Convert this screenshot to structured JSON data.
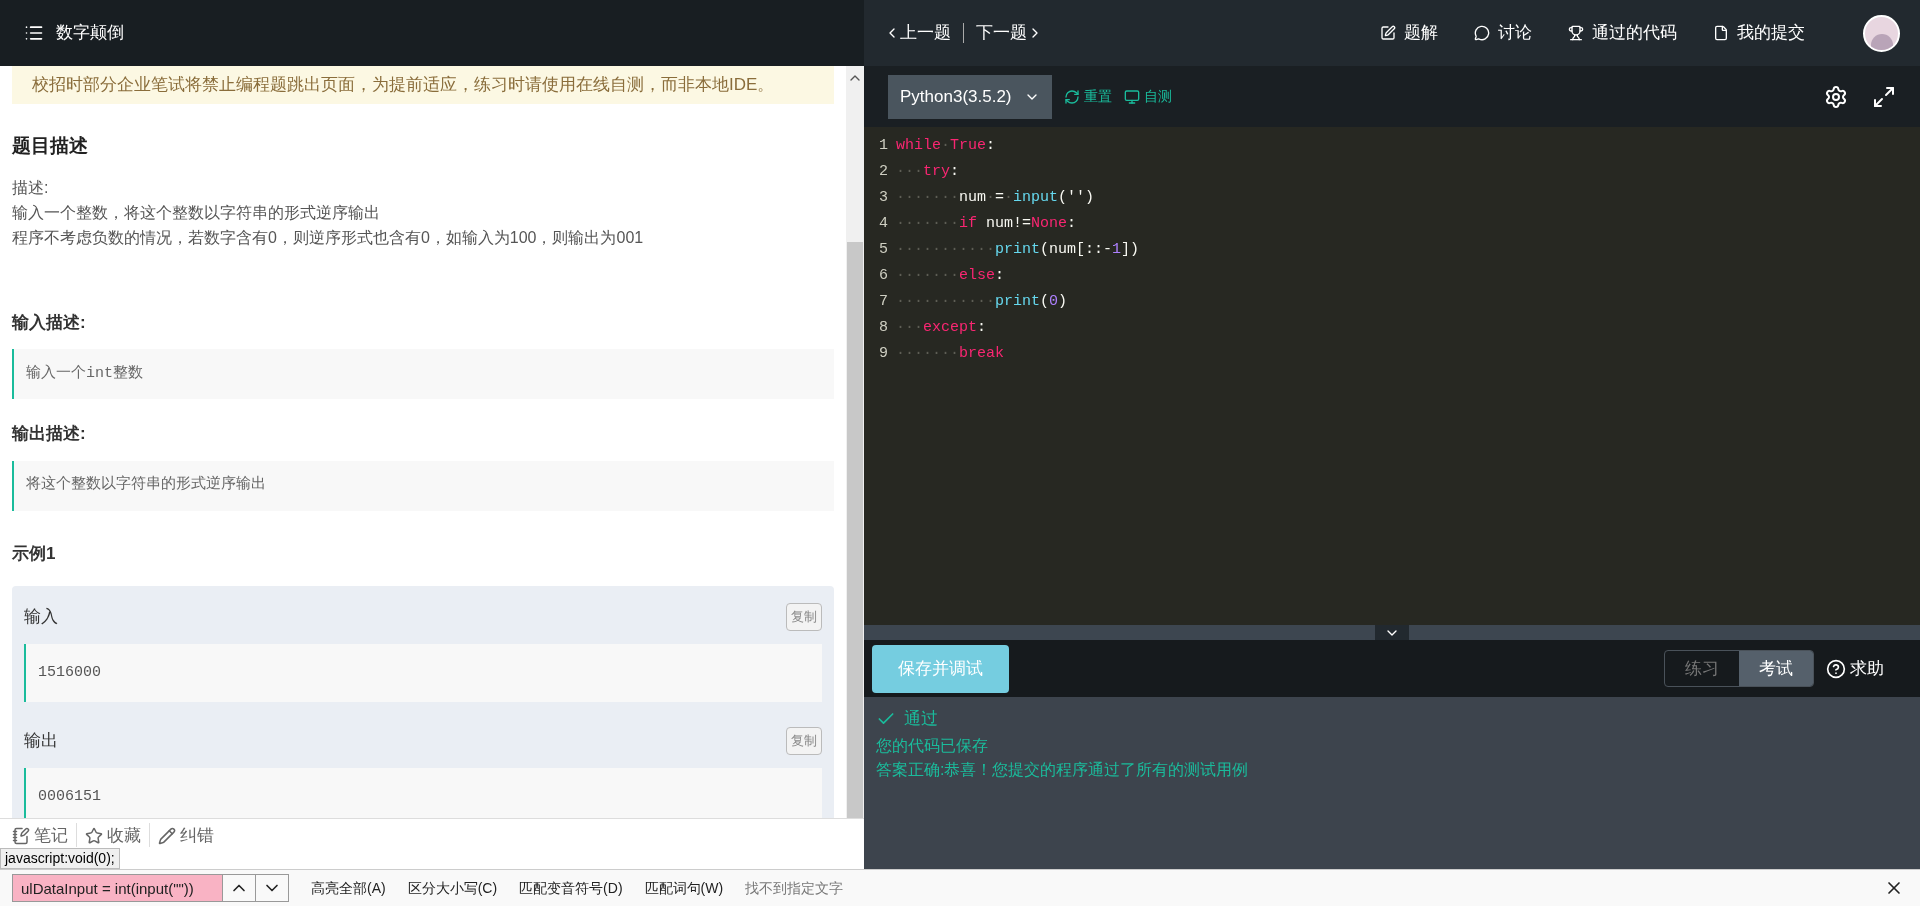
{
  "header": {
    "title": "数字颠倒",
    "prev": "上一题",
    "next": "下一题",
    "links": [
      {
        "label": "题解"
      },
      {
        "label": "讨论"
      },
      {
        "label": "通过的代码"
      },
      {
        "label": "我的提交"
      }
    ]
  },
  "problem": {
    "notice": "校招时部分企业笔试将禁止编程题跳出页面，为提前适应，练习时请使用在线自测，而非本地IDE。",
    "heading": "题目描述",
    "description": [
      "描述:",
      "输入一个整数，将这个整数以字符串的形式逆序输出",
      "程序不考虑负数的情况，若数字含有0，则逆序形式也含有0，如输入为100，则输出为001"
    ],
    "sections": [
      {
        "heading": "输入描述:",
        "body": "输入一个int整数"
      },
      {
        "heading": "输出描述:",
        "body": "将这个整数以字符串的形式逆序输出"
      }
    ],
    "example": {
      "heading": "示例1",
      "blocks": [
        {
          "label": "输入",
          "copy": "复制",
          "value": "1516000"
        },
        {
          "label": "输出",
          "copy": "复制",
          "value": "0006151"
        }
      ]
    }
  },
  "actions": [
    {
      "label": "笔记"
    },
    {
      "label": "收藏"
    },
    {
      "label": "纠错"
    }
  ],
  "status_tooltip": "javascript:void(0);",
  "editor": {
    "language": "Python3(3.5.2)",
    "reset": "重置",
    "self_test": "自测",
    "lines": [
      {
        "number": "1",
        "tokens": [
          {
            "kind": "keyword",
            "text": "while"
          },
          {
            "kind": "ws",
            "text": "·"
          },
          {
            "kind": "keyword",
            "text": "True"
          },
          {
            "kind": "plain",
            "text": ":"
          }
        ]
      },
      {
        "number": "2",
        "tokens": [
          {
            "kind": "ws",
            "text": "···"
          },
          {
            "kind": "keyword",
            "text": "try"
          },
          {
            "kind": "plain",
            "text": ":"
          }
        ]
      },
      {
        "number": "3",
        "tokens": [
          {
            "kind": "ws",
            "text": "·······"
          },
          {
            "kind": "plain",
            "text": "num"
          },
          {
            "kind": "ws",
            "text": "·"
          },
          {
            "kind": "plain",
            "text": "="
          },
          {
            "kind": "ws",
            "text": "·"
          },
          {
            "kind": "builtin",
            "text": "input"
          },
          {
            "kind": "plain",
            "text": "('')"
          }
        ]
      },
      {
        "number": "4",
        "tokens": [
          {
            "kind": "ws",
            "text": "·······"
          },
          {
            "kind": "keyword",
            "text": "if"
          },
          {
            "kind": "plain",
            "text": " num!="
          },
          {
            "kind": "keyword",
            "text": "None"
          },
          {
            "kind": "plain",
            "text": ":"
          }
        ]
      },
      {
        "number": "5",
        "tokens": [
          {
            "kind": "ws",
            "text": "···········"
          },
          {
            "kind": "builtin",
            "text": "print"
          },
          {
            "kind": "plain",
            "text": "(num[::-"
          },
          {
            "kind": "number",
            "text": "1"
          },
          {
            "kind": "plain",
            "text": "])"
          }
        ]
      },
      {
        "number": "6",
        "tokens": [
          {
            "kind": "ws",
            "text": "·······"
          },
          {
            "kind": "keyword",
            "text": "else"
          },
          {
            "kind": "plain",
            "text": ":"
          }
        ]
      },
      {
        "number": "7",
        "tokens": [
          {
            "kind": "ws",
            "text": "···········"
          },
          {
            "kind": "builtin",
            "text": "print"
          },
          {
            "kind": "plain",
            "text": "("
          },
          {
            "kind": "number",
            "text": "0"
          },
          {
            "kind": "plain",
            "text": ")"
          }
        ]
      },
      {
        "number": "8",
        "tokens": [
          {
            "kind": "ws",
            "text": "···"
          },
          {
            "kind": "keyword",
            "text": "except"
          },
          {
            "kind": "plain",
            "text": ":"
          }
        ]
      },
      {
        "number": "9",
        "tokens": [
          {
            "kind": "ws",
            "text": "·······"
          },
          {
            "kind": "keyword",
            "text": "break"
          }
        ]
      }
    ]
  },
  "run_bar": {
    "save_button": "保存并调试",
    "modes": [
      {
        "label": "练习",
        "selected": false
      },
      {
        "label": "考试",
        "selected": true
      }
    ],
    "help": "求助"
  },
  "result": {
    "status": "通过",
    "messages": [
      "您的代码已保存",
      "答案正确:恭喜！您提交的程序通过了所有的测试用例"
    ]
  },
  "find_bar": {
    "value": "ulDataInput = int(input(\"\"))",
    "options": [
      "高亮全部(A)",
      "区分大小写(C)",
      "匹配变音符号(D)",
      "匹配词句(W)"
    ],
    "message": "找不到指定文字"
  }
}
